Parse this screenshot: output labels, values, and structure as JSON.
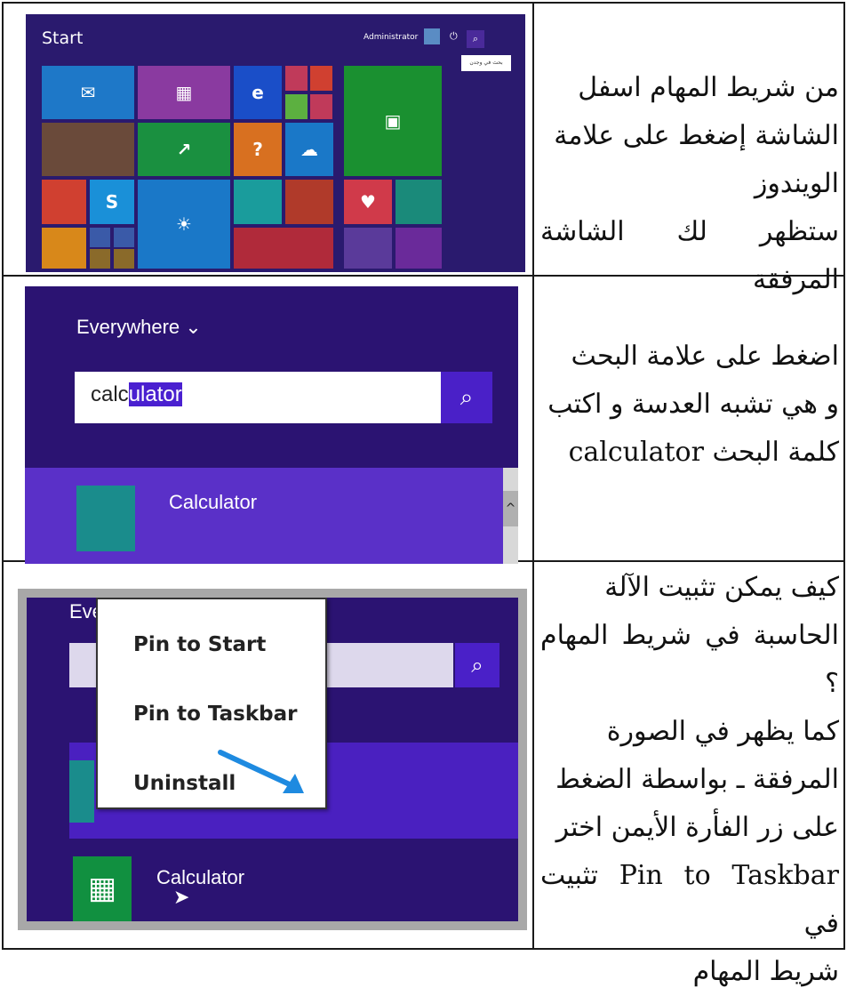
{
  "rows": [
    {
      "text_lines": [
        "من شريط المهام اسفل",
        "الشاشة إضغط على علامة",
        "الويندوز",
        "ستظهر لك الشاشة المرفقة"
      ],
      "screenshot": {
        "title": "Start",
        "user": "Administrator",
        "tooltip": "بحث في وجدن",
        "tiles_colors": [
          "#1e78c8",
          "#8a3aa0",
          "#1a4ec8",
          "#d04030",
          "#5cb040",
          "#c03a5a",
          "#d87020",
          "#2aa0c0"
        ]
      }
    },
    {
      "text_lines": [
        "اضغط على علامة البحث",
        "و هي تشبه العدسة و اكتب",
        "كلمة البحث calculator"
      ],
      "screenshot": {
        "scope": "Everywhere",
        "typed_plain": "calc",
        "typed_highlighted": "ulator",
        "result": "Calculator"
      }
    },
    {
      "text_lines": [
        "كيف يمكن تثبيت الآلة",
        "الحاسبة في شريط المهام ؟",
        "كما يظهر في الصورة",
        "المرفقة ـ بواسطة الضغط",
        "على زر الفأرة الأيمن اختر",
        "Pin to Taskbar تثبيت في",
        "شريط المهام"
      ],
      "screenshot": {
        "scope": "Everywhere",
        "menu_items": [
          "Pin to Start",
          "Pin to Taskbar",
          "Uninstall"
        ],
        "result": "Calculator"
      }
    }
  ],
  "icons": {
    "chevron": "chevron-down-icon",
    "search": "search-icon"
  }
}
